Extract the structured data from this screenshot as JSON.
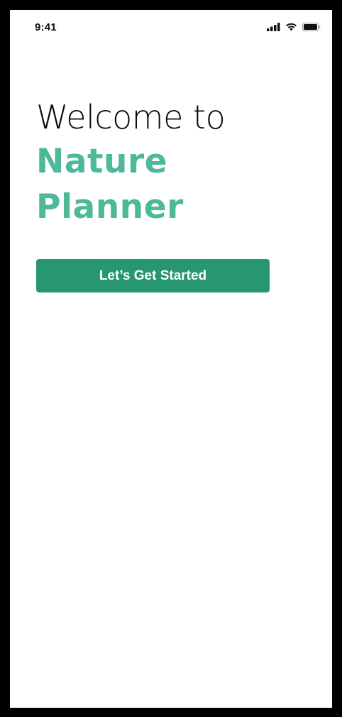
{
  "status_bar": {
    "time": "9:41",
    "icons": [
      "cellular-signal-icon",
      "wifi-icon",
      "battery-icon"
    ]
  },
  "welcome": {
    "line1": "Welcome to",
    "line2": "Nature",
    "line3": "Planner"
  },
  "cta": {
    "label": "Let’s Get Started"
  },
  "colors": {
    "accent_text": "#4db89a",
    "button_bg": "#279770",
    "button_text": "#ffffff",
    "background": "#ffffff",
    "frame": "#000000"
  }
}
